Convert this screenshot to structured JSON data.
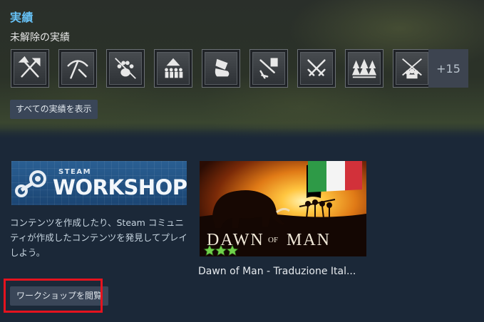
{
  "achievements": {
    "title": "実績",
    "subtitle": "未解除の実績",
    "icons": [
      "crossed-axe-spear-icon",
      "pickaxe-icon",
      "paw-print-icon",
      "tribe-hut-icon",
      "pouring-bowl-icon",
      "hammer-strike-icon",
      "crossed-swords-icon",
      "pine-forest-icon",
      "crossed-spears-people-icon"
    ],
    "more_count": "+15",
    "show_all_label": "すべての実績を表示"
  },
  "workshop": {
    "logo_steam": "STEAM",
    "logo_workshop": "WORKSHOP",
    "description": "コンテンツを作成したり、Steam コミュニティが作成したコンテンツを発見してプレイしよう。",
    "browse_label": "ワークショップを閲覧"
  },
  "featured_item": {
    "game_logo_left": "DAWN",
    "game_logo_mid": "OF",
    "game_logo_right": "MAN",
    "title": "Dawn of Man - Traduzione Ital...",
    "flag_colors": [
      "#2e9a47",
      "#f4f4f4",
      "#d2313a"
    ],
    "rating_stars": 3
  },
  "colors": {
    "accent": "#66c0f4",
    "background": "#1b2838",
    "button": "#3a4658",
    "highlight": "#e5131e"
  }
}
